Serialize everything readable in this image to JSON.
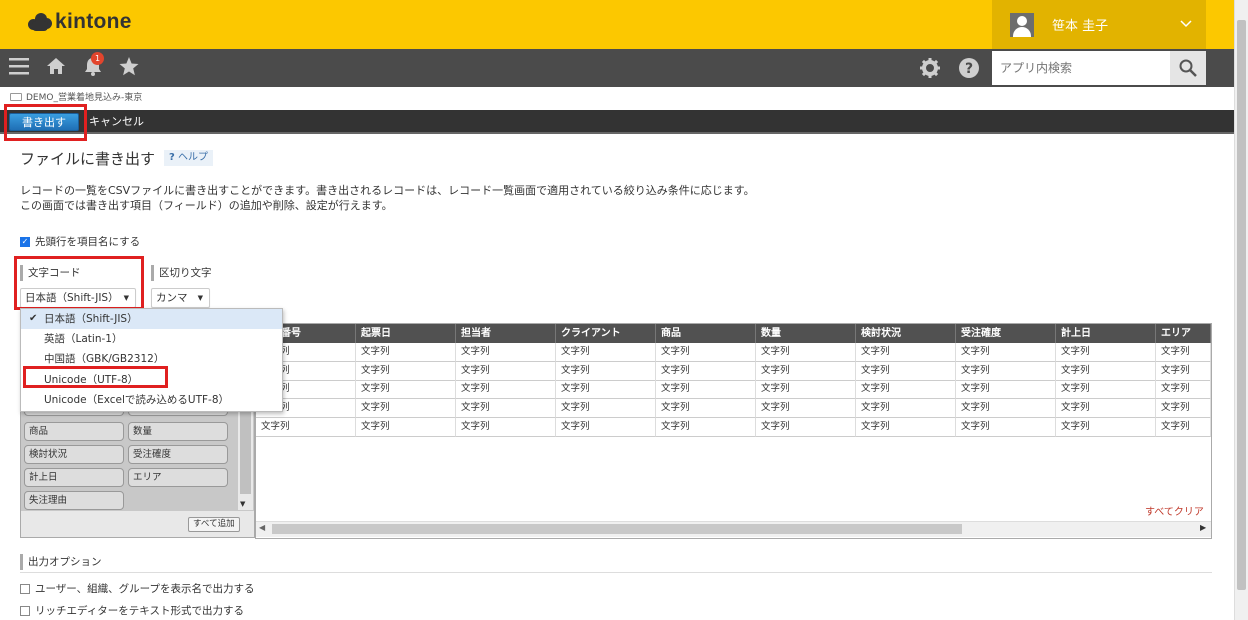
{
  "header": {
    "logo_text": "kintone",
    "user_name": "笹本 圭子",
    "user_chevron": "chevron-down-icon",
    "notification_count": "1",
    "search_placeholder": "アプリ内検索"
  },
  "breadcrumb": {
    "app_name": "DEMO_営業着地見込み-東京"
  },
  "actions": {
    "export_label": "書き出す",
    "cancel_label": "キャンセル"
  },
  "page": {
    "title": "ファイルに書き出す",
    "help_label": "ヘルプ",
    "help_mark": "?",
    "description_line1": "レコードの一覧をCSVファイルに書き出すことができます。書き出されるレコードは、レコード一覧画面で適用されている絞り込み条件に応じます。",
    "description_line2": "この画面では書き出す項目（フィールド）の追加や削除、設定が行えます。",
    "header_row_checkbox": "先頭行を項目名にする"
  },
  "encoding": {
    "label": "文字コード",
    "selected": "日本語（Shift-JIS）",
    "options": [
      "日本語（Shift-JIS）",
      "英語（Latin-1）",
      "中国語（GBK/GB2312）",
      "Unicode（UTF-8）",
      "Unicode（Excelで読み込めるUTF-8）"
    ]
  },
  "delimiter": {
    "label": "区切り文字",
    "selected": "カンマ"
  },
  "fields_panel": {
    "chips": [
      "商品",
      "数量",
      "検討状況",
      "受注確度",
      "計上日",
      "エリア",
      "失注理由"
    ],
    "add_all_label": "すべて追加"
  },
  "table": {
    "columns": [
      "ード番号",
      "起票日",
      "担当者",
      "クライアント",
      "商品",
      "数量",
      "検討状況",
      "受注確度",
      "計上日",
      "エリア"
    ],
    "cell_text": "文字列",
    "clear_all_label": "すべてクリア"
  },
  "output_options": {
    "label": "出力オプション",
    "option1": "ユーザー、組織、グループを表示名で出力する",
    "option2": "リッチエディターをテキスト形式で出力する"
  }
}
